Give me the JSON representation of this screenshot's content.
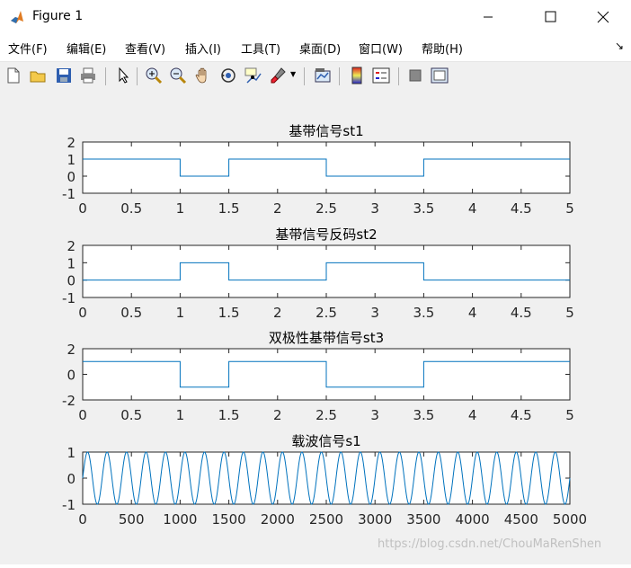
{
  "window": {
    "title": "Figure 1"
  },
  "menu": {
    "items": [
      "文件(F)",
      "编辑(E)",
      "查看(V)",
      "插入(I)",
      "工具(T)",
      "桌面(D)",
      "窗口(W)",
      "帮助(H)"
    ],
    "dock_arrow": "↘"
  },
  "toolbar": {
    "icons": [
      "new-figure-icon",
      "open-file-icon",
      "save-icon",
      "print-icon",
      "edit-plot-arrow-icon",
      "zoom-in-icon",
      "zoom-out-icon",
      "pan-hand-icon",
      "rotate-3d-icon",
      "data-cursor-icon",
      "brush-icon",
      "link-plot-icon",
      "colorbar-icon",
      "legend-icon",
      "hide-plot-tools-icon",
      "show-plot-tools-icon"
    ]
  },
  "watermark": "https://blog.csdn.net/ChouMaRenShen",
  "colors": {
    "line": "#0072bd",
    "axes_bg": "#ffffff",
    "figure_bg": "#f0f0f0"
  },
  "chart_data": [
    {
      "type": "line",
      "title": "基带信号st1",
      "x": [
        0,
        1,
        1,
        1.5,
        1.5,
        2.5,
        2.5,
        3.5,
        3.5,
        5
      ],
      "y": [
        1,
        1,
        0,
        0,
        1,
        1,
        0,
        0,
        1,
        1
      ],
      "xlim": [
        0,
        5
      ],
      "ylim": [
        -1,
        2
      ],
      "xticks": [
        "0",
        "0.5",
        "1",
        "1.5",
        "2",
        "2.5",
        "3",
        "3.5",
        "4",
        "4.5",
        "5"
      ],
      "yticks": [
        "2",
        "1",
        "0",
        "-1"
      ]
    },
    {
      "type": "line",
      "title": "基带信号反码st2",
      "x": [
        0,
        1,
        1,
        1.5,
        1.5,
        2.5,
        2.5,
        3.5,
        3.5,
        5
      ],
      "y": [
        0,
        0,
        1,
        1,
        0,
        0,
        1,
        1,
        0,
        0
      ],
      "xlim": [
        0,
        5
      ],
      "ylim": [
        -1,
        2
      ],
      "xticks": [
        "0",
        "0.5",
        "1",
        "1.5",
        "2",
        "2.5",
        "3",
        "3.5",
        "4",
        "4.5",
        "5"
      ],
      "yticks": [
        "2",
        "1",
        "0",
        "-1"
      ]
    },
    {
      "type": "line",
      "title": "双极性基带信号st3",
      "x": [
        0,
        1,
        1,
        1.5,
        1.5,
        2.5,
        2.5,
        3.5,
        3.5,
        5
      ],
      "y": [
        1,
        1,
        -1,
        -1,
        1,
        1,
        -1,
        -1,
        1,
        1
      ],
      "xlim": [
        0,
        5
      ],
      "ylim": [
        -2,
        2
      ],
      "xticks": [
        "0",
        "0.5",
        "1",
        "1.5",
        "2",
        "2.5",
        "3",
        "3.5",
        "4",
        "4.5",
        "5"
      ],
      "yticks": [
        "2",
        "0",
        "-2"
      ]
    },
    {
      "type": "line",
      "title": "载波信号s1",
      "function": "sin",
      "cycles": 25,
      "amplitude": 1,
      "xlim": [
        0,
        5000
      ],
      "ylim": [
        -1,
        1
      ],
      "xticks": [
        "0",
        "500",
        "1000",
        "1500",
        "2000",
        "2500",
        "3000",
        "3500",
        "4000",
        "4500",
        "5000"
      ],
      "yticks": [
        "1",
        "0",
        "-1"
      ]
    }
  ]
}
